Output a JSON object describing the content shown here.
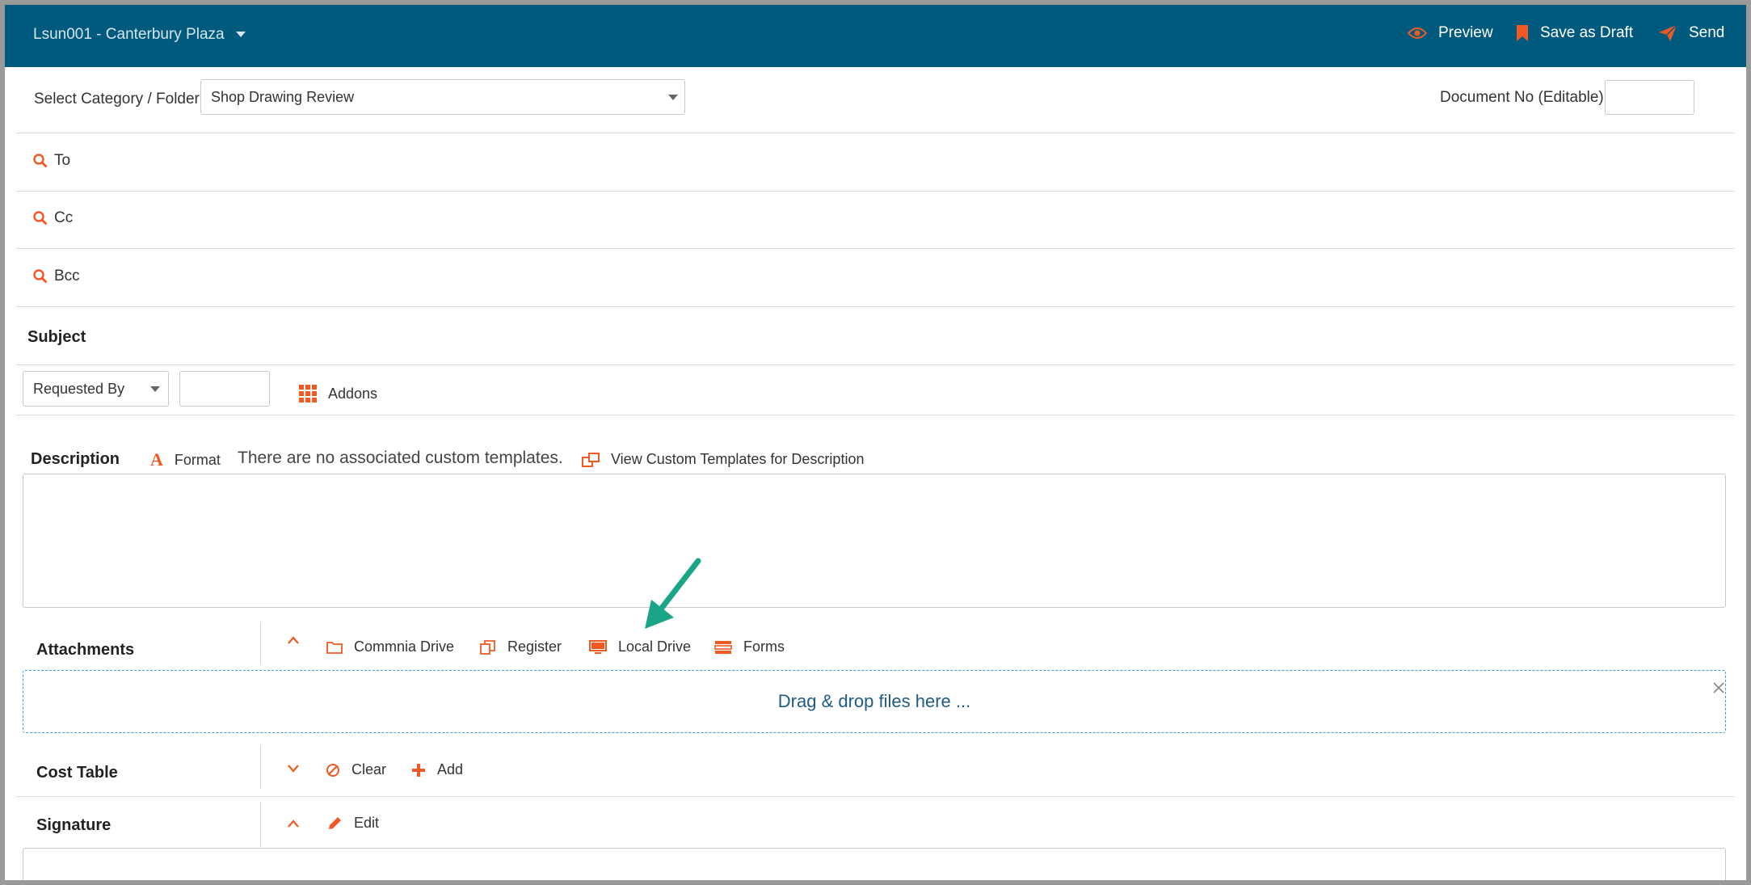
{
  "header": {
    "project": "Lsun001 - Canterbury Plaza",
    "preview": "Preview",
    "save_draft": "Save as Draft",
    "send": "Send"
  },
  "category": {
    "label": "Select Category / Folder",
    "value": "Shop Drawing Review"
  },
  "document_no": {
    "label": "Document No (Editable):",
    "value": ""
  },
  "recipients": {
    "to": "To",
    "cc": "Cc",
    "bcc": "Bcc"
  },
  "subject": {
    "label": "Subject"
  },
  "requested": {
    "select_value": "Requested By",
    "input_value": "",
    "addons": "Addons"
  },
  "description": {
    "label": "Description",
    "format": "Format",
    "no_templates": "There are no associated custom templates.",
    "view_templates": "View Custom Templates for Description"
  },
  "attachments": {
    "label": "Attachments",
    "commnia_drive": "Commnia Drive",
    "register": "Register",
    "local_drive": "Local Drive",
    "forms": "Forms",
    "dropzone": "Drag & drop files here ..."
  },
  "cost_table": {
    "label": "Cost Table",
    "clear": "Clear",
    "add": "Add"
  },
  "signature": {
    "label": "Signature",
    "edit": "Edit"
  },
  "colors": {
    "header_bg": "#005a7d",
    "accent": "#f05a22",
    "arrow": "#1aa588",
    "dropzone_border": "#3c9fd3"
  }
}
